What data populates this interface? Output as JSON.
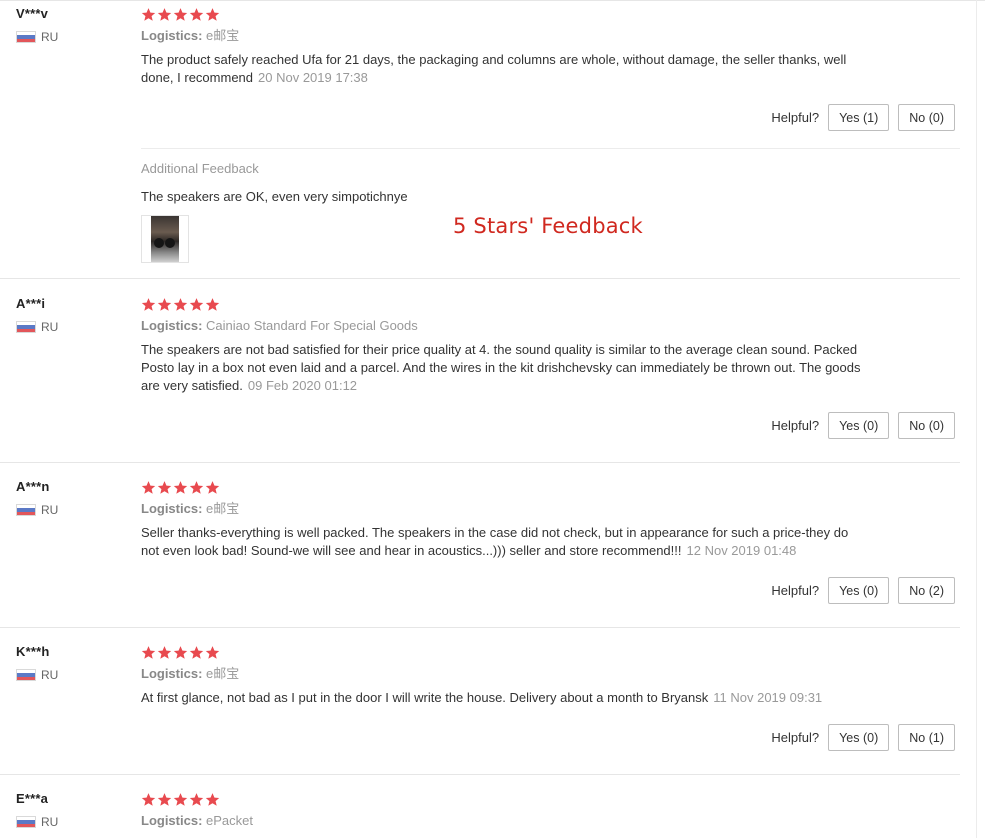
{
  "overlay_caption": "5 Stars' Feedback",
  "colors": {
    "star": "#e84a4f",
    "caption": "#d0281f",
    "flag_blue": "#5b79c6",
    "flag_red": "#e2565a"
  },
  "helpful_label": "Helpful?",
  "logistics_label": "Logistics:",
  "reviews": [
    {
      "user": "V***v",
      "country": "RU",
      "stars": 5,
      "logistics": "e邮宝",
      "text": "The product safely reached Ufa for 21 days, the packaging and columns are whole, without damage, the seller thanks, well done, I recommend",
      "date": "20 Nov 2019 17:38",
      "yes": "Yes (1)",
      "no": "No (0)",
      "additional": {
        "title": "Additional Feedback",
        "text": "The speakers are OK, even very simpotichnye",
        "image": "speaker-photo"
      }
    },
    {
      "user": "A***i",
      "country": "RU",
      "stars": 5,
      "logistics": "Cainiao Standard For Special Goods",
      "text": "The speakers are not bad satisfied for their price quality at 4. the sound quality is similar to the average clean sound. Packed Posto lay in a box not even laid and a parcel. And the wires in the kit drishchevsky can immediately be thrown out. The goods are very satisfied.",
      "date": "09 Feb 2020 01:12",
      "yes": "Yes (0)",
      "no": "No (0)"
    },
    {
      "user": "A***n",
      "country": "RU",
      "stars": 5,
      "logistics": "e邮宝",
      "text": "Seller thanks-everything is well packed. The speakers in the case did not check, but in appearance for such a price-they do not even look bad! Sound-we will see and hear in acoustics...))) seller and store recommend!!!",
      "date": "12 Nov 2019 01:48",
      "yes": "Yes (0)",
      "no": "No (2)"
    },
    {
      "user": "K***h",
      "country": "RU",
      "stars": 5,
      "logistics": "e邮宝",
      "text": "At first glance, not bad as I put in the door I will write the house. Delivery about a month to Bryansk",
      "date": "11 Nov 2019 09:31",
      "yes": "Yes (0)",
      "no": "No (1)"
    },
    {
      "user": "E***a",
      "country": "RU",
      "stars": 5,
      "logistics": "ePacket"
    }
  ]
}
